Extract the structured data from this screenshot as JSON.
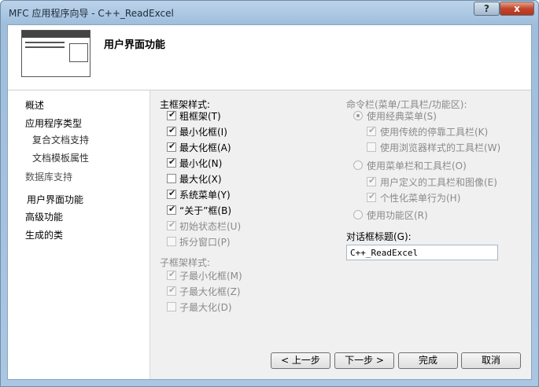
{
  "window": {
    "title": "MFC 应用程序向导 - C++_ReadExcel",
    "help_label": "?",
    "close_label": "x"
  },
  "header": {
    "title": "用户界面功能"
  },
  "nav": {
    "items": [
      {
        "label": "概述"
      },
      {
        "label": "应用程序类型"
      },
      {
        "label": "复合文档支持"
      },
      {
        "label": "文档模板属性"
      },
      {
        "label": "数据库支持"
      },
      {
        "label": "用户界面功能",
        "selected": true
      },
      {
        "label": "高级功能"
      },
      {
        "label": "生成的类"
      }
    ]
  },
  "main_frame": {
    "title": "主框架样式:",
    "options": [
      {
        "label": "粗框架(T)",
        "checked": true,
        "enabled": true
      },
      {
        "label": "最小化框(I)",
        "checked": true,
        "enabled": true
      },
      {
        "label": "最大化框(A)",
        "checked": true,
        "enabled": true
      },
      {
        "label": "最小化(N)",
        "checked": true,
        "enabled": true
      },
      {
        "label": "最大化(X)",
        "checked": false,
        "enabled": true
      },
      {
        "label": "系统菜单(Y)",
        "checked": true,
        "enabled": true
      },
      {
        "label": "“关于”框(B)",
        "checked": true,
        "enabled": true
      },
      {
        "label": "初始状态栏(U)",
        "checked": true,
        "enabled": false
      },
      {
        "label": "拆分窗口(P)",
        "checked": false,
        "enabled": false
      }
    ]
  },
  "child_frame": {
    "title": "子框架样式:",
    "options": [
      {
        "label": "子最小化框(M)",
        "checked": true,
        "enabled": false
      },
      {
        "label": "子最大化框(Z)",
        "checked": true,
        "enabled": false
      },
      {
        "label": "子最大化(D)",
        "checked": false,
        "enabled": false
      }
    ]
  },
  "command_bar": {
    "title": "命令栏(菜单/工具栏/功能区):",
    "classic_menu": "使用经典菜单(S)",
    "classic_opts": [
      {
        "label": "使用传统的停靠工具栏(K)",
        "checked": true
      },
      {
        "label": "使用浏览器样式的工具栏(W)",
        "checked": false
      }
    ],
    "menubar_toolbar": "使用菜单栏和工具栏(O)",
    "menubar_opts": [
      {
        "label": "用户定义的工具栏和图像(E)",
        "checked": true
      },
      {
        "label": "个性化菜单行为(H)",
        "checked": true
      }
    ],
    "ribbon": "使用功能区(R)"
  },
  "dialog_title": {
    "label": "对话框标题(G):",
    "value": "C++_ReadExcel"
  },
  "buttons": {
    "prev": "< 上一步",
    "next": "下一步 >",
    "finish": "完成",
    "cancel": "取消"
  }
}
